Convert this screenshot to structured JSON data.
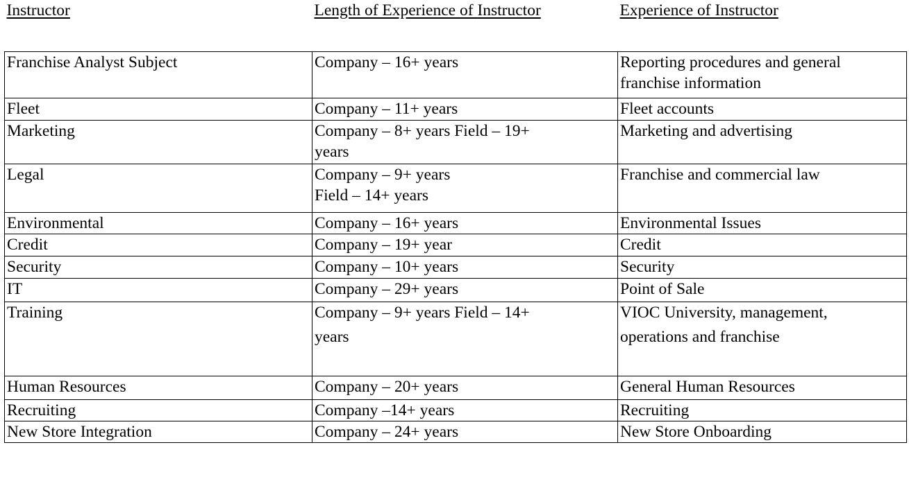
{
  "header": {
    "col1": "Instructor",
    "col2_part1": "Length of Experience of ",
    "col2_part2": "Instructor",
    "col3": "Experience of Instructor"
  },
  "rows": [
    {
      "instructor": "Franchise Analyst Subject",
      "length": [
        "Company – 16+ years"
      ],
      "experience": [
        "Reporting procedures and general",
        "franchise information"
      ]
    },
    {
      "instructor": "Fleet",
      "length": [
        "Company – 11+ years"
      ],
      "experience": [
        "Fleet accounts"
      ]
    },
    {
      "instructor": "Marketing",
      "length": [
        "Company – 8+ years Field – 19+",
        "years"
      ],
      "experience": [
        "Marketing and advertising"
      ]
    },
    {
      "instructor": "Legal",
      "length": [
        "Company – 9+ years",
        "Field – 14+ years"
      ],
      "experience": [
        "Franchise and commercial law"
      ]
    },
    {
      "instructor": "Environmental",
      "length": [
        "Company – 16+ years"
      ],
      "experience": [
        "Environmental Issues"
      ]
    },
    {
      "instructor": "Credit",
      "length": [
        "Company – 19+ year"
      ],
      "experience": [
        "Credit"
      ]
    },
    {
      "instructor": "Security",
      "length": [
        "Company – 10+ years"
      ],
      "experience": [
        "Security"
      ]
    },
    {
      "instructor": "IT",
      "length": [
        "Company – 29+ years"
      ],
      "experience": [
        "Point of Sale"
      ]
    },
    {
      "instructor": "Training",
      "length": [
        "Company – 9+ years Field – 14+",
        "years"
      ],
      "experience": [
        "VIOC University, management,",
        "operations and franchise"
      ]
    },
    {
      "instructor": "Human Resources",
      "length": [
        "Company – 20+ years"
      ],
      "experience": [
        "General Human Resources"
      ]
    },
    {
      "instructor": "Recruiting",
      "length": [
        "Company –14+ years"
      ],
      "experience": [
        "Recruiting"
      ]
    },
    {
      "instructor": "New Store Integration",
      "length": [
        "Company – 24+ years"
      ],
      "experience": [
        "New Store Onboarding"
      ]
    }
  ]
}
